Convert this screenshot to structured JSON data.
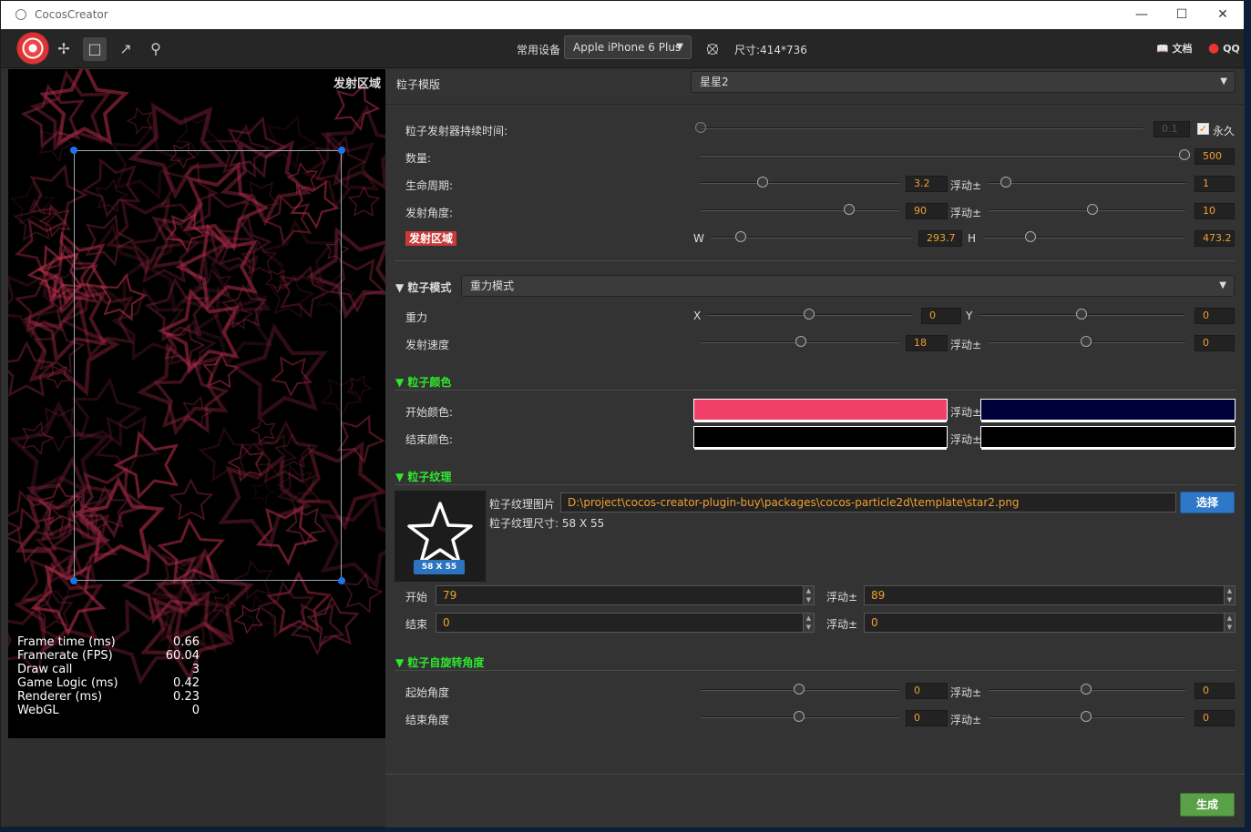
{
  "window": {
    "title": "CocosCreator"
  },
  "toolbar": {
    "device_label": "常用设备",
    "device_value": "Apple iPhone 6 Plus",
    "size_text": "尺寸:414*736",
    "docs_label": "文档",
    "qq_label": "QQ"
  },
  "preview": {
    "emit_label": "发射区域",
    "stats": [
      {
        "name": "Frame time (ms)",
        "value": "0.66"
      },
      {
        "name": "Framerate (FPS)",
        "value": "60.04"
      },
      {
        "name": "Draw call",
        "value": "3"
      },
      {
        "name": "Game Logic (ms)",
        "value": "0.42"
      },
      {
        "name": "Renderer (ms)",
        "value": "0.23"
      },
      {
        "name": "WebGL",
        "value": "0"
      }
    ]
  },
  "panel": {
    "template_label": "粒子模版",
    "template_value": "星星2",
    "duration_label": "粒子发射器持续时间:",
    "duration_value": "0.1",
    "forever_label": "永久",
    "count_label": "数量:",
    "count_value": "500",
    "life_label": "生命周期:",
    "life_value": "3.2",
    "life_var_label": "浮动±",
    "life_var_value": "1",
    "angle_label": "发射角度:",
    "angle_value": "90",
    "angle_var_label": "浮动±",
    "angle_var_value": "10",
    "area_label": "发射区域",
    "w_label": "W",
    "w_value": "293.7",
    "h_label": "H",
    "h_value": "473.2",
    "mode_section": "粒子模式",
    "mode_value": "重力模式",
    "gravity_label": "重力",
    "gx_label": "X",
    "gx_value": "0",
    "gy_label": "Y",
    "gy_value": "0",
    "speed_label": "发射速度",
    "speed_value": "18",
    "speed_var_label": "浮动±",
    "speed_var_value": "0",
    "color_section": "粒子颜色",
    "start_color_label": "开始颜色:",
    "start_color": "#f0406a",
    "start_color_var_label": "浮动±",
    "start_color_var": "#00003a",
    "end_color_label": "结束颜色:",
    "end_color": "#000000",
    "end_color_var_label": "浮动±",
    "end_color_var": "#000000",
    "texture_section": "粒子纹理",
    "texture_label": "粒子纹理图片",
    "texture_path": "D:\\project\\cocos-creator-plugin-buy\\packages\\cocos-particle2d\\template\\star2.png",
    "select_button": "选择",
    "texture_size_text": "粒子纹理尺寸: 58 X 55",
    "texture_badge": "58 X 55",
    "size_start_label": "开始",
    "size_start_value": "79",
    "size_start_var_label": "浮动±",
    "size_start_var_value": "89",
    "size_end_label": "结束",
    "size_end_value": "0",
    "size_end_var_label": "浮动±",
    "size_end_var_value": "0",
    "spin_section": "粒子自旋转角度",
    "spin_start_label": "起始角度",
    "spin_start_value": "0",
    "spin_start_var_label": "浮动±",
    "spin_start_var_value": "0",
    "spin_end_label": "结束角度",
    "spin_end_value": "0",
    "spin_end_var_label": "浮动±",
    "spin_end_var_value": "0",
    "generate_button": "生成"
  },
  "colors": {
    "accent_green": "#2ee82e",
    "value_orange": "#f0a030",
    "button_blue": "#2f78c8",
    "button_green": "#5aa048"
  }
}
